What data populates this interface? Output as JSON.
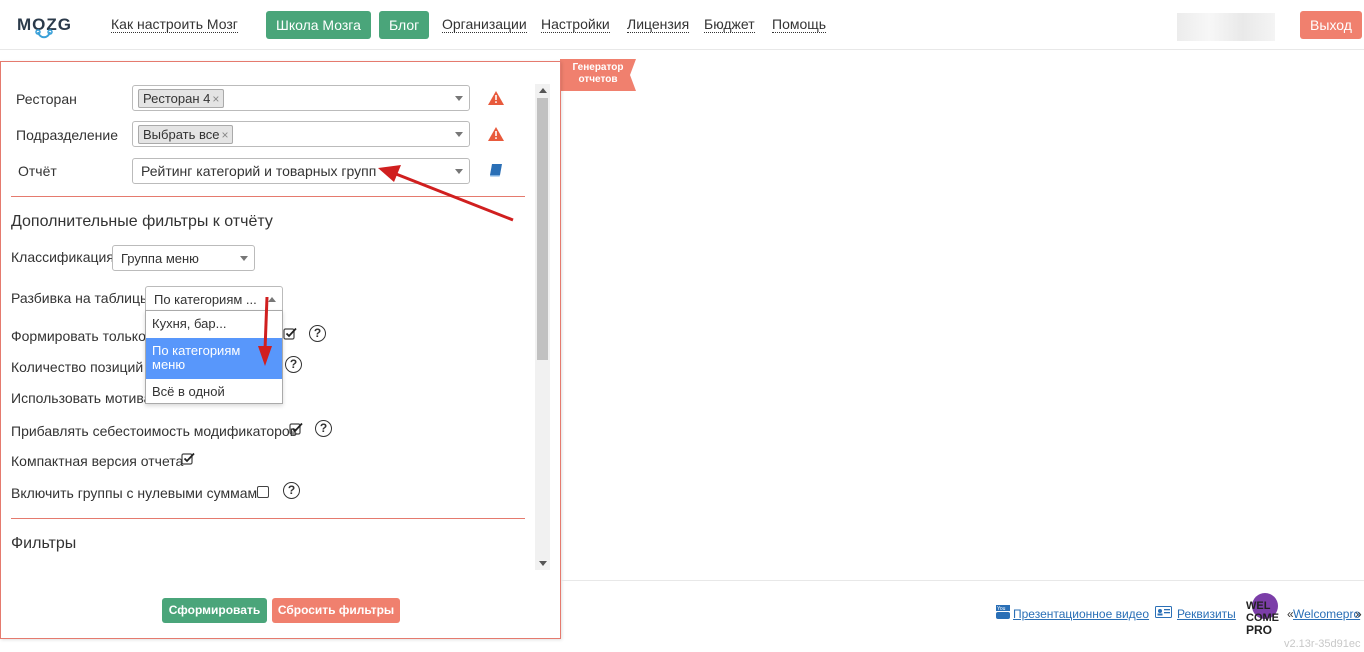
{
  "header": {
    "logo_text": "MOZG",
    "nav": {
      "how_to": "Как настроить Мозг",
      "school": "Школа Мозга",
      "blog": "Блог",
      "organizations": "Организации",
      "settings": "Настройки",
      "license": "Лицензия",
      "budget": "Бюджет",
      "help": "Помощь"
    },
    "logout": "Выход"
  },
  "tab_tag": {
    "line1": "Генератор",
    "line2": "отчетов"
  },
  "form": {
    "restaurant_label": "Ресторан",
    "restaurant_chip": "Ресторан 4",
    "department_label": "Подразделение",
    "department_chip": "Выбрать все",
    "chip_remove": "×",
    "report_label": "Отчёт",
    "report_value": "Рейтинг категорий и товарных групп",
    "extra_filters_title": "Дополнительные фильтры к отчёту",
    "classification_label": "Классификация",
    "classification_value": "Группа меню",
    "split_label": "Разбивка на таблицы",
    "split_value": "По категориям ...",
    "split_options": [
      "Кухня, бар...",
      "По категориям меню",
      "Всё в одной"
    ],
    "form_only_label": "Формировать только в",
    "positions_label": "Количество позиций м",
    "use_motiv_label": "Использовать мотива",
    "add_cost_label": "Прибавлять себестоимость модификаторов",
    "compact_label": "Компактная версия отчета",
    "zero_groups_label": "Включить группы с нулевыми суммами",
    "filters_title": "Фильтры",
    "help_glyph": "?"
  },
  "actions": {
    "build": "Сформировать",
    "reset": "Сбросить фильтры"
  },
  "footer": {
    "video": "Презентационное видео",
    "requisites": "Реквизиты",
    "prefix": "«",
    "welcomepro": "Welcomepro",
    "suffix": "»",
    "version": "v2.13r-35d91ec",
    "wp_logo_lines": [
      "WEL",
      "COME",
      "PRO"
    ]
  },
  "colors": {
    "green": "#4aa57a",
    "red": "#f0806e",
    "border_red": "#e57a6e",
    "selected_blue": "#5897fb",
    "arrow": "#d01f1f"
  }
}
